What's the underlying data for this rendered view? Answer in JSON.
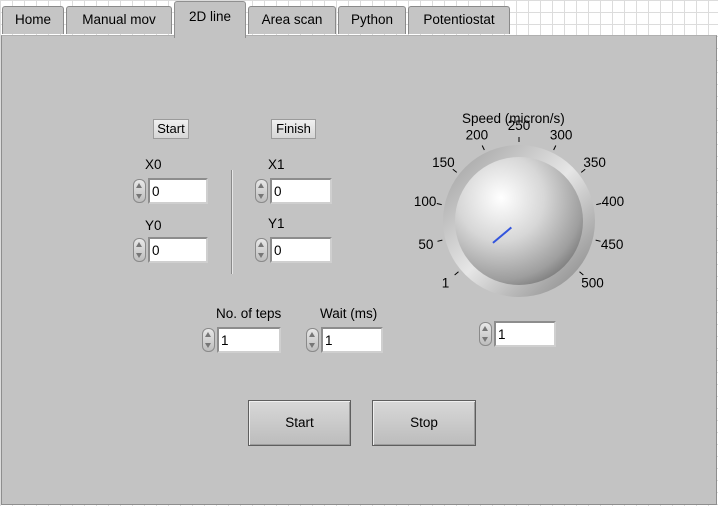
{
  "tabs": [
    {
      "label": "Home",
      "active": false
    },
    {
      "label": "Manual mov",
      "active": false
    },
    {
      "label": "2D line",
      "active": true
    },
    {
      "label": "Area scan",
      "active": false
    },
    {
      "label": "Python",
      "active": false
    },
    {
      "label": "Potentiostat",
      "active": false
    }
  ],
  "start_point": {
    "button_label": "Start",
    "x_label": "X0",
    "x_value": "0",
    "y_label": "Y0",
    "y_value": "0"
  },
  "finish_point": {
    "button_label": "Finish",
    "x_label": "X1",
    "x_value": "0",
    "y_label": "Y1",
    "y_value": "0"
  },
  "steps": {
    "label": "No. of teps",
    "value": "1"
  },
  "wait": {
    "label": "Wait (ms)",
    "value": "1"
  },
  "speed": {
    "label": "Speed (micron/s)",
    "value": "1",
    "dial_value": 1,
    "min": 1,
    "max": 500,
    "tick_labels": [
      "1",
      "50",
      "100",
      "150",
      "200",
      "250",
      "300",
      "350",
      "400",
      "450",
      "500"
    ],
    "needle_color": "#3355dd"
  },
  "actions": {
    "start_label": "Start",
    "stop_label": "Stop"
  }
}
